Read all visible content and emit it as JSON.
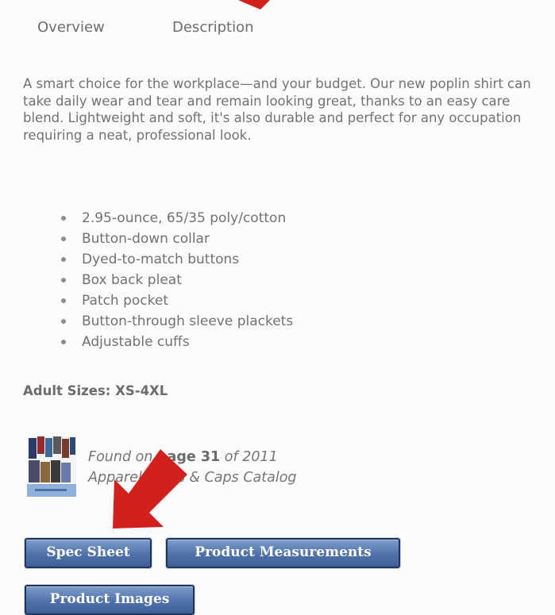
{
  "tabs": [
    {
      "label": "Overview"
    },
    {
      "label": "Description"
    }
  ],
  "description": "A smart choice for the workplace—and your budget. Our new poplin shirt can take daily wear and tear and remain looking great, thanks to an easy care blend. Lightweight and soft, it's also durable and perfect for any occupation requiring a neat, professional look.",
  "features": [
    "2.95-ounce, 65/35 poly/cotton",
    "Button-down collar",
    "Dyed-to-match buttons",
    "Box back pleat",
    "Patch pocket",
    "Button-through sleeve plackets",
    "Adjustable cuffs"
  ],
  "sizes": "Adult Sizes: XS-4XL",
  "catalog": {
    "found_on": "Found on",
    "page": "page 31",
    "of_year": "of 2011",
    "catalog_name": "Apparel, Bags & Caps Catalog"
  },
  "buttons": {
    "spec_sheet": "Spec Sheet",
    "product_measurements": "Product Measurements",
    "product_images": "Product Images"
  },
  "colors": {
    "arrow": "#d4201c",
    "button": "#4f72ab"
  }
}
